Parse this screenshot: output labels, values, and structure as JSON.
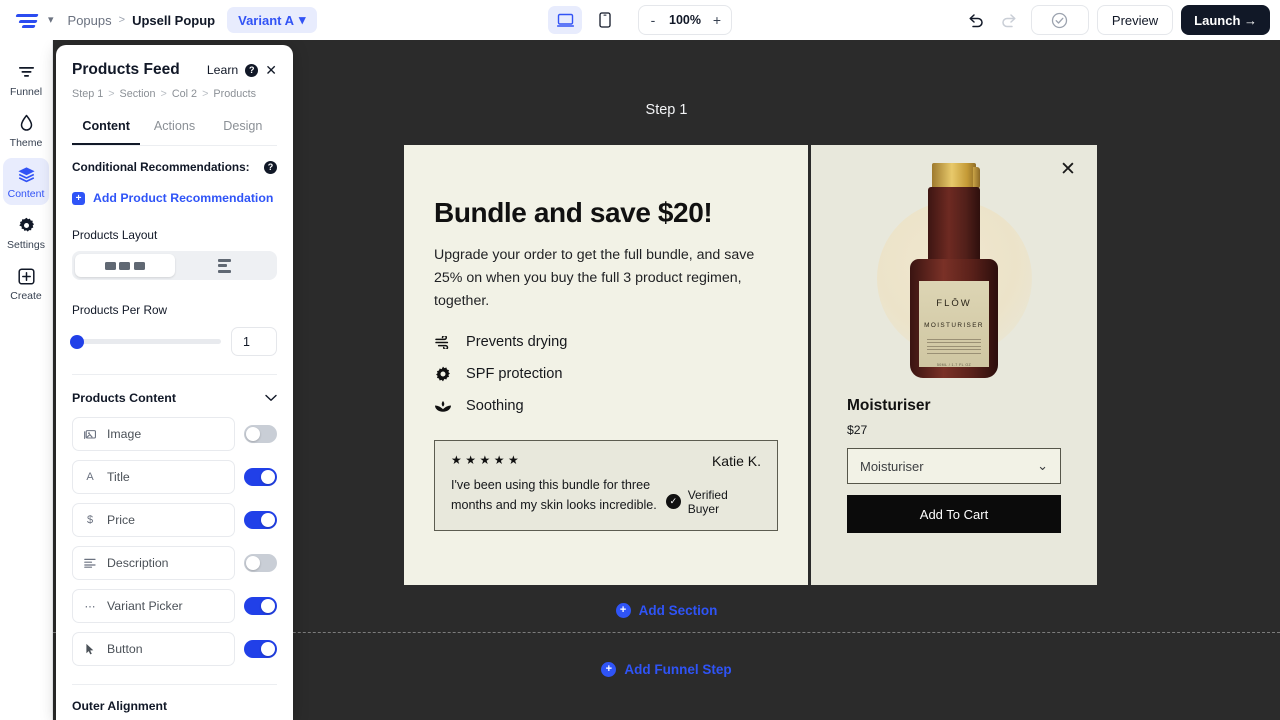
{
  "topbar": {
    "logo_name": "flow-logo",
    "workspace_chevron": "chevron-down-icon",
    "breadcrumb": {
      "parent": "Popups",
      "separator": ">",
      "current": "Upsell Popup"
    },
    "variant": {
      "label": "Variant A",
      "chevron": "chevron-down-icon"
    },
    "devices": [
      {
        "name": "desktop-view",
        "icon": "desktop-icon",
        "active": true
      },
      {
        "name": "mobile-view",
        "icon": "mobile-icon",
        "active": false
      }
    ],
    "zoom": {
      "minus": "-",
      "value": "100%",
      "plus": "+"
    },
    "undo_icon": "undo-icon",
    "redo_icon": "redo-icon",
    "status_icon": "check-circle-icon",
    "preview_label": "Preview",
    "launch_label": "Launch →"
  },
  "rail": {
    "items": [
      {
        "label": "Funnel",
        "icon": "funnel-icon",
        "active": false
      },
      {
        "label": "Theme",
        "icon": "droplet-icon",
        "active": false
      },
      {
        "label": "Content",
        "icon": "layers-icon",
        "active": true
      },
      {
        "label": "Settings",
        "icon": "gear-icon",
        "active": false
      },
      {
        "label": "Create",
        "icon": "plus-box-icon",
        "active": false
      }
    ]
  },
  "panel": {
    "title": "Products Feed",
    "learn_label": "Learn",
    "help_glyph": "?",
    "close_glyph": "✕",
    "breadcrumb": [
      "Step 1",
      "Section",
      "Col 2",
      "Products"
    ],
    "breadcrumb_separator": ">",
    "tabs": [
      {
        "label": "Content",
        "active": true
      },
      {
        "label": "Actions",
        "active": false
      },
      {
        "label": "Design",
        "active": false
      }
    ],
    "conditional_label": "Conditional Recommendations:",
    "add_reco_label": "Add Product Recommendation",
    "add_reco_glyph": "+",
    "layout_label": "Products Layout",
    "layout_options": [
      {
        "name": "grid-layout",
        "active": true
      },
      {
        "name": "list-layout",
        "active": false
      }
    ],
    "per_row_label": "Products Per Row",
    "per_row_value": "1",
    "content_section_title": "Products Content",
    "content_chevron": "chevron-down-icon",
    "content_rows": [
      {
        "label": "Image",
        "icon": "image-icon",
        "glyph": "▣",
        "on": false
      },
      {
        "label": "Title",
        "icon": "text-icon",
        "glyph": "A",
        "on": true
      },
      {
        "label": "Price",
        "icon": "dollar-icon",
        "glyph": "$",
        "on": true
      },
      {
        "label": "Description",
        "icon": "lines-icon",
        "glyph": "≡",
        "on": false
      },
      {
        "label": "Variant Picker",
        "icon": "dots-icon",
        "glyph": "⋯",
        "on": true
      },
      {
        "label": "Button",
        "icon": "cursor-icon",
        "glyph": "➤",
        "on": true
      }
    ],
    "outer_alignment_label": "Outer Alignment"
  },
  "canvas": {
    "step_label": "Step 1",
    "add_section_label": "Add Section",
    "add_funnel_step_label": "Add Funnel Step",
    "plus_glyph": "+"
  },
  "popup": {
    "close_glyph": "✕",
    "headline": "Bundle and save $20!",
    "subcopy": "Upgrade your order to get the full bundle, and save 25% on when you buy the full 3 product regimen, together.",
    "benefits": [
      {
        "text": "Prevents drying",
        "icon": "wind-icon"
      },
      {
        "text": "SPF protection",
        "icon": "sun-icon"
      },
      {
        "text": "Soothing",
        "icon": "lotus-icon"
      }
    ],
    "review": {
      "stars": "★★★★★",
      "text": "I've been using this bundle for three months and my skin looks incredible.",
      "author": "Katie K.",
      "verified_label": "Verified Buyer",
      "verified_glyph": "✓"
    },
    "product": {
      "image_brand": "FLŌW",
      "image_name": "MOISTURISER",
      "image_volume": "50ML / 1.7 FL OZ",
      "title": "Moisturiser",
      "price": "$27",
      "variant_selected": "Moisturiser",
      "variant_chevron": "chevron-down-icon",
      "cta_label": "Add To Cart"
    }
  },
  "colors": {
    "accent_blue": "#2f54f7",
    "dark": "#111827",
    "canvas_bg": "#2b2b2b",
    "popup_left_bg": "#f2f2e6",
    "popup_right_bg": "#e8e8dc"
  }
}
